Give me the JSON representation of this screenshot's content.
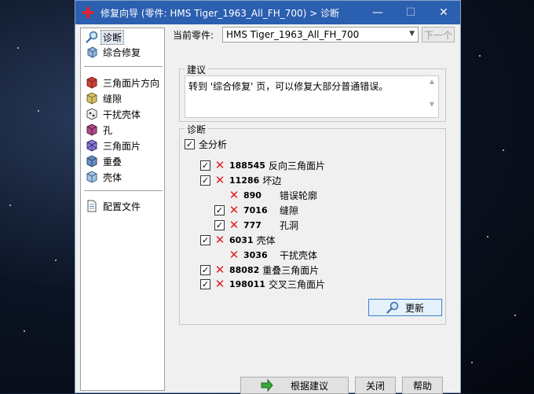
{
  "window": {
    "title": "修复向导 (零件: HMS Tiger_1963_All_FH_700) > 诊断",
    "minimize": "—",
    "maximize": "☐",
    "close": "✕"
  },
  "sidebar": {
    "items": [
      {
        "label": "诊断",
        "icon": "magnifier-icon"
      },
      {
        "label": "综合修复",
        "icon": "cube-repair-icon"
      },
      {
        "label": "三角面片方向",
        "icon": "triangle-direction-icon"
      },
      {
        "label": "缝隙",
        "icon": "gap-icon"
      },
      {
        "label": "干扰壳体",
        "icon": "intersecting-shells-icon"
      },
      {
        "label": "孔",
        "icon": "hole-icon"
      },
      {
        "label": "三角面片",
        "icon": "triangles-icon"
      },
      {
        "label": "重叠",
        "icon": "overlap-icon"
      },
      {
        "label": "壳体",
        "icon": "shell-icon"
      },
      {
        "label": "配置文件",
        "icon": "document-icon"
      }
    ]
  },
  "part": {
    "label": "当前零件:",
    "value": "HMS Tiger_1963_All_FH_700",
    "next_label": "下一个"
  },
  "advice": {
    "group_title": "建议",
    "text": "转到 '综合修复' 页，可以修复大部分普通错误。"
  },
  "diagnosis": {
    "group_title": "诊断",
    "full_analysis": "全分析",
    "rows": [
      {
        "count": "188545",
        "label": "反向三角面片",
        "checked": true
      },
      {
        "count": "11286",
        "label": "坏边",
        "checked": true
      },
      {
        "count": "890",
        "label": "错误轮廓",
        "checked": null
      },
      {
        "count": "7016",
        "label": "缝隙",
        "checked": true
      },
      {
        "count": "777",
        "label": "孔洞",
        "checked": true
      },
      {
        "count": "6031",
        "label": "壳体",
        "checked": true
      },
      {
        "count": "3036",
        "label": "干扰壳体",
        "checked": null
      },
      {
        "count": "88082",
        "label": "重叠三角面片",
        "checked": true
      },
      {
        "count": "198011",
        "label": "交叉三角面片",
        "checked": true
      }
    ],
    "update_label": "更新"
  },
  "buttons": {
    "apply": "根据建议",
    "close": "关闭",
    "help": "帮助"
  },
  "colors": {
    "titlebar": "#2b5fb0",
    "error_mark": "#e02020",
    "selection": "#dfe6f2"
  }
}
